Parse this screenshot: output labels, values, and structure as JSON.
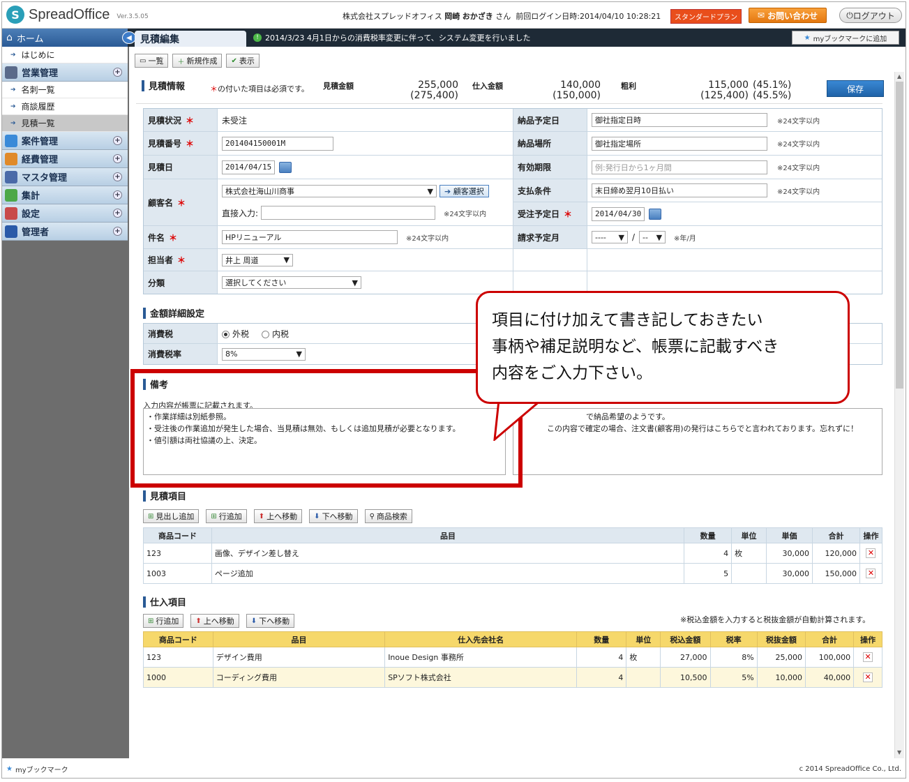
{
  "app": {
    "logo_text": "SpreadOffice",
    "version": "Ver.3.5.05",
    "company": "株式会社スプレッドオフィス",
    "user_last": "岡崎",
    "user_first": "おかざき",
    "honorific": "さん",
    "last_login_label": "前回ログイン日時:",
    "last_login": "2014/04/10 10:28:21",
    "plan": "スタンダードプラン",
    "contact_label": "お問い合わせ",
    "logout_label": "ログアウト"
  },
  "nav": {
    "home": "ホーム",
    "page_title": "見積編集",
    "notice": "2014/3/23  4月1日からの消費税率変更に伴って、システム変更を行いました",
    "bookmark_add": "myブックマークに追加"
  },
  "sidebar": {
    "items": [
      {
        "type": "sub",
        "label": "はじめに"
      },
      {
        "type": "cat",
        "label": "営業管理",
        "color": "#5a6a8a"
      },
      {
        "type": "sub",
        "label": "名刺一覧"
      },
      {
        "type": "sub",
        "label": "商談履歴"
      },
      {
        "type": "sub",
        "label": "見積一覧",
        "active": true
      },
      {
        "type": "cat",
        "label": "案件管理",
        "color": "#3a8ad8"
      },
      {
        "type": "cat",
        "label": "経費管理",
        "color": "#e08a2a"
      },
      {
        "type": "cat",
        "label": "マスタ管理",
        "color": "#4a6aa8"
      },
      {
        "type": "cat",
        "label": "集計",
        "color": "#4ca848"
      },
      {
        "type": "cat",
        "label": "設定",
        "color": "#c84a4a"
      },
      {
        "type": "cat",
        "label": "管理者",
        "color": "#2a5aa8"
      }
    ],
    "footer": "myブックマーク"
  },
  "toolbar": {
    "list": "一覧",
    "new": "新規作成",
    "view": "表示"
  },
  "estimate": {
    "section_title": "見積情報",
    "required_note_mark": "＊",
    "required_note": "の付いた項目は必須です。",
    "amount_label": "見積金額",
    "amount": "255,000",
    "amount_tax": "(275,400)",
    "cost_label": "仕入金額",
    "cost": "140,000",
    "cost_tax": "(150,000)",
    "profit_label": "粗利",
    "profit": "115,000",
    "profit_tax": "(125,400)",
    "profit_pct": "(45.1%)",
    "profit_pct_tax": "(45.5%)",
    "save": "保存"
  },
  "form": {
    "req_mark": "＊",
    "limit": "※24文字以内",
    "status_label": "見積状況",
    "status": "未受注",
    "number_label": "見積番号",
    "number": "201404150001M",
    "date_label": "見積日",
    "date": "2014/04/15",
    "customer_label": "顧客名",
    "customer": "株式会社海山川商事",
    "customer_select": "顧客選択",
    "direct_label": "直接入力:",
    "subject_label": "件名",
    "subject": "HPリニューアル",
    "staff_label": "担当者",
    "staff": "井上 周道",
    "category_label": "分類",
    "category": "選択してください",
    "delivery_date_label": "納品予定日",
    "delivery_date": "御社指定日時",
    "delivery_place_label": "納品場所",
    "delivery_place": "御社指定場所",
    "validity_label": "有効期限",
    "validity_placeholder": "例:発行日から1ヶ月間",
    "payment_label": "支払条件",
    "payment": "末日締め翌月10日払い",
    "order_date_label": "受注予定日",
    "order_date": "2014/04/30",
    "billing_label": "請求予定月",
    "billing_year": "----",
    "billing_month": "--",
    "billing_sep": "/",
    "billing_note": "※年/月"
  },
  "amount_detail": {
    "title": "金額詳細設定",
    "tax_label": "消費税",
    "tax_excl": "外税",
    "tax_incl": "内税",
    "rate_label": "消費税率",
    "rate": "8%"
  },
  "notes": {
    "title": "備考",
    "hint": "入力内容が帳票に記載されます。",
    "left": "・作業詳細は別紙参照。\n・受注後の作業追加が発生した場合、当見積は無効、もしくは追加見積が必要となります。\n・値引額は両社協議の上、決定。",
    "right_line1": "で納品希望のようです。",
    "right_line2": "この内容で確定の場合、注文書(顧客用)の発行はこちらでと言われております。忘れずに！"
  },
  "callout": {
    "line1": "項目に付け加えて書き記しておきたい",
    "line2": "事柄や補足説明など、帳票に記載すべき",
    "line3": "内容をご入力下さい。"
  },
  "items": {
    "title": "見積項目",
    "buttons": [
      "見出し追加",
      "行追加",
      "上へ移動",
      "下へ移動",
      "商品検索"
    ],
    "headers": [
      "商品コード",
      "品目",
      "数量",
      "単位",
      "単価",
      "合計",
      "操作"
    ],
    "rows": [
      {
        "code": "123",
        "name": "画像、デザイン差し替え",
        "qty": "4",
        "unit": "枚",
        "price": "30,000",
        "total": "120,000"
      },
      {
        "code": "1003",
        "name": "ページ追加",
        "qty": "5",
        "unit": "",
        "price": "30,000",
        "total": "150,000"
      }
    ]
  },
  "purchase": {
    "title": "仕入項目",
    "buttons": [
      "行追加",
      "上へ移動",
      "下へ移動"
    ],
    "note": "※税込金額を入力すると税抜金額が自動計算されます。",
    "headers": [
      "商品コード",
      "品目",
      "仕入先会社名",
      "数量",
      "単位",
      "税込金額",
      "税率",
      "税抜金額",
      "合計",
      "操作"
    ],
    "rows": [
      {
        "code": "123",
        "name": "デザイン費用",
        "vendor": "Inoue Design 事務所",
        "qty": "4",
        "unit": "枚",
        "incl": "27,000",
        "rate": "8%",
        "excl": "25,000",
        "total": "100,000"
      },
      {
        "code": "1000",
        "name": "コーディング費用",
        "vendor": "SPソフト株式会社",
        "qty": "4",
        "unit": "",
        "incl": "10,500",
        "rate": "5%",
        "excl": "10,000",
        "total": "40,000"
      }
    ]
  },
  "footer": {
    "copyright": "c 2014 SpreadOffice Co., Ltd."
  }
}
